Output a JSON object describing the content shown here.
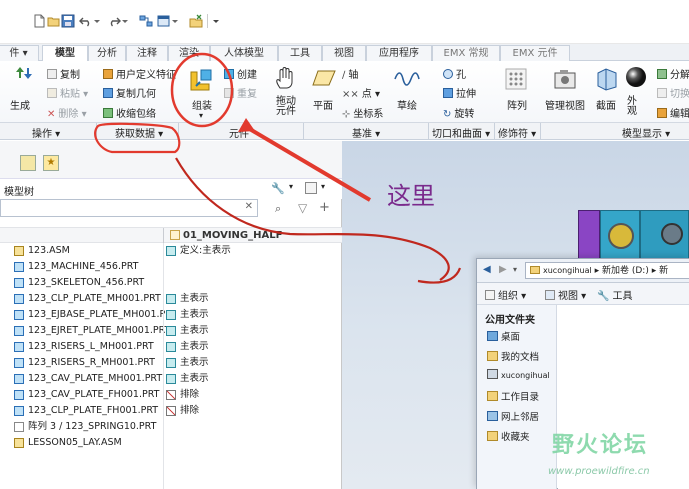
{
  "quick_access": {
    "icons": [
      "new-icon",
      "open-icon",
      "save-icon",
      "undo-icon",
      "redo-icon",
      "regenerate-icon",
      "windows-icon",
      "close-icon",
      "customize-icon"
    ]
  },
  "tabs": [
    {
      "label": "件 ▾"
    },
    {
      "label": "模型"
    },
    {
      "label": "分析"
    },
    {
      "label": "注释"
    },
    {
      "label": "渲染"
    },
    {
      "label": "人体模型"
    },
    {
      "label": "工具"
    },
    {
      "label": "视图"
    },
    {
      "label": "应用程序"
    },
    {
      "label": "EMX 常规"
    },
    {
      "label": "EMX 元件"
    }
  ],
  "ribbon": {
    "operations": {
      "regenerate": "生成",
      "copy": "复制",
      "paste": "粘贴",
      "delete": "删除"
    },
    "get_data": {
      "udf": "用户定义特征",
      "copy_geom": "复制几何",
      "shrinkwrap": "收缩包络"
    },
    "component": {
      "assemble": "组装",
      "create": "创建",
      "repeat": "重复"
    },
    "manikin": {
      "drag": "拖动元件"
    },
    "datum": {
      "plane": "平面",
      "axis": "轴",
      "point": "点",
      "csys": "坐标系",
      "sketch": "草绘"
    },
    "cut_surface": {
      "hole": "孔",
      "extrude": "拉伸",
      "revolve": "旋转"
    },
    "modifiers": {
      "pattern": "阵列"
    },
    "model_display": {
      "manager": "管理视图",
      "section": "截面",
      "appearance": "外观",
      "explode": "分解",
      "toggle": "切换",
      "edit": "编辑"
    }
  },
  "groups": {
    "operations": "操作 ▾",
    "get_data": "获取数据 ▾",
    "component": "元件",
    "datum": "基准 ▾",
    "cut_surface": "切口和曲面 ▾",
    "modifiers": "修饰符 ▾",
    "model_display": "模型显示 ▾"
  },
  "tree": {
    "title": "模型树",
    "column_header": "01_MOVING_HALF",
    "rows": [
      {
        "name": "123.ASM",
        "status": "定义:主表示",
        "type": "asm"
      },
      {
        "name": "123_MACHINE_456.PRT",
        "status": "",
        "type": "prt"
      },
      {
        "name": "123_SKELETON_456.PRT",
        "status": "",
        "type": "prt"
      },
      {
        "name": "123_CLP_PLATE_MH001.PRT",
        "status": "主表示",
        "type": "prt"
      },
      {
        "name": "123_EJBASE_PLATE_MH001.PI",
        "status": "主表示",
        "type": "prt"
      },
      {
        "name": "123_EJRET_PLATE_MH001.PRT",
        "status": "主表示",
        "type": "prt"
      },
      {
        "name": "123_RISERS_L_MH001.PRT",
        "status": "主表示",
        "type": "prt"
      },
      {
        "name": "123_RISERS_R_MH001.PRT",
        "status": "主表示",
        "type": "prt"
      },
      {
        "name": "123_CAV_PLATE_MH001.PRT",
        "status": "主表示",
        "type": "prt"
      },
      {
        "name": "123_CAV_PLATE_FH001.PRT",
        "status": "排除",
        "type": "prt-x"
      },
      {
        "name": "123_CLP_PLATE_FH001.PRT",
        "status": "排除",
        "type": "prt-x"
      },
      {
        "name": "阵列 3 / 123_SPRING10.PRT",
        "status": "",
        "type": "pattern"
      },
      {
        "name": "LESSON05_LAY.ASM",
        "status": "",
        "type": "asm"
      }
    ]
  },
  "explorer": {
    "address": [
      "xucongihual",
      "新加卷 (D:)",
      "新"
    ],
    "toolbar": {
      "organize": "组织 ▾",
      "views": "视图 ▾",
      "tools": "工具"
    },
    "side_header": "公用文件夹",
    "side_items": [
      "桌面",
      "我的文档",
      "xucongihual",
      "工作目录",
      "网上邻居",
      "收藏夹"
    ]
  },
  "annotation": {
    "label": "这里",
    "color": "#7a2a8c",
    "circle_color": "#e23a2e"
  },
  "watermark": {
    "text": "野火论坛",
    "url": "www.proewildfire.cn"
  }
}
